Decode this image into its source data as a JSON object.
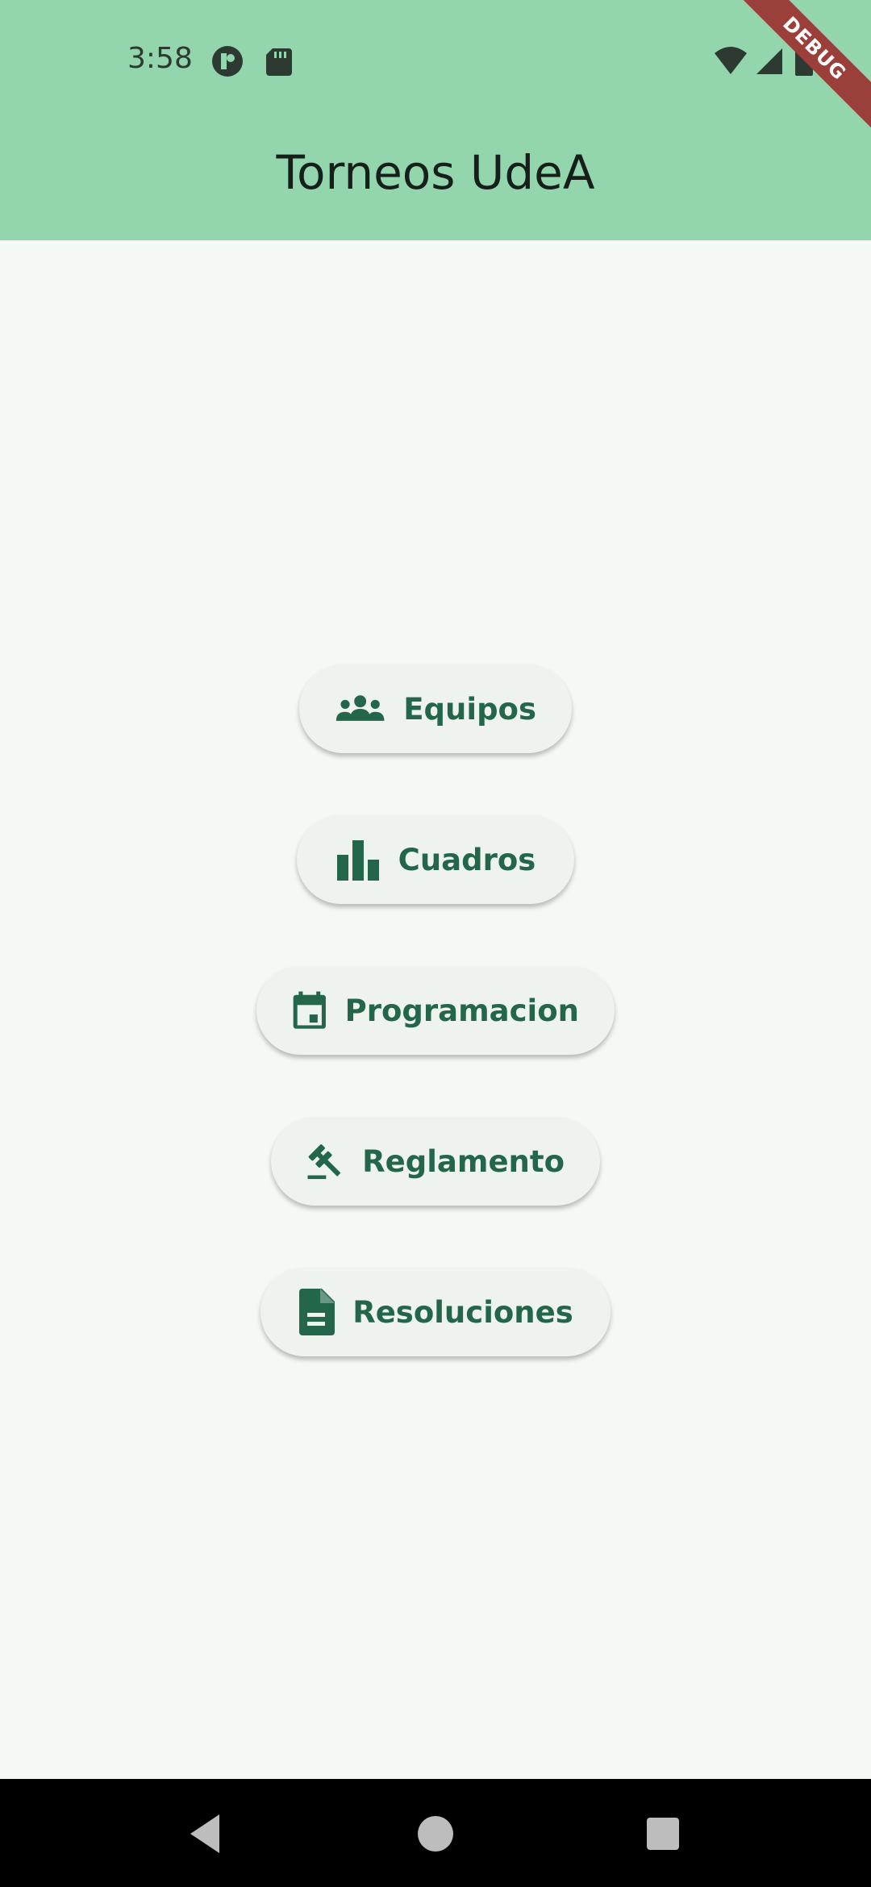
{
  "status_bar": {
    "time": "3:58",
    "icons": [
      "app-indicator-icon",
      "sd-card-icon",
      "wifi-icon",
      "signal-icon",
      "battery-icon"
    ]
  },
  "debug_banner": "DEBUG",
  "app_bar": {
    "title": "Torneos UdeA",
    "background": "#93d6ad"
  },
  "menu": {
    "items": [
      {
        "label": "Equipos",
        "icon": "groups-icon"
      },
      {
        "label": "Cuadros",
        "icon": "bar-chart-icon"
      },
      {
        "label": "Programacion",
        "icon": "calendar-icon"
      },
      {
        "label": "Reglamento",
        "icon": "gavel-icon"
      },
      {
        "label": "Resoluciones",
        "icon": "document-icon"
      }
    ],
    "accent": "#23664a"
  },
  "nav_bar": {
    "icons": [
      "back-icon",
      "home-icon",
      "recents-icon"
    ]
  }
}
